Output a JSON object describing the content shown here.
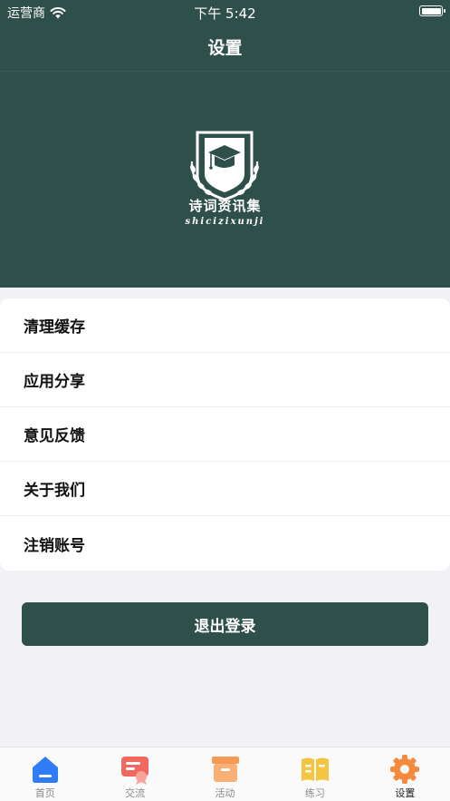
{
  "status_bar": {
    "carrier": "运营商",
    "time": "下午 5:42"
  },
  "nav": {
    "title": "设置"
  },
  "logo": {
    "cn_text": "诗词资讯集",
    "en_text": "shicizixunji"
  },
  "menu": {
    "items": [
      {
        "label": "清理缓存"
      },
      {
        "label": "应用分享"
      },
      {
        "label": "意见反馈"
      },
      {
        "label": "关于我们"
      },
      {
        "label": "注销账号"
      }
    ]
  },
  "logout_label": "退出登录",
  "tabs": [
    {
      "label": "首页",
      "icon": "home-icon",
      "color": "#2f7cf6"
    },
    {
      "label": "交流",
      "icon": "chat-icon",
      "color": "#f0685f"
    },
    {
      "label": "活动",
      "icon": "box-icon",
      "color": "#f59a54"
    },
    {
      "label": "练习",
      "icon": "book-icon",
      "color": "#f5c542"
    },
    {
      "label": "设置",
      "icon": "gear-icon",
      "color": "#f58a3c"
    }
  ],
  "colors": {
    "primary": "#2f4f4b",
    "background": "#f2f2f6"
  }
}
